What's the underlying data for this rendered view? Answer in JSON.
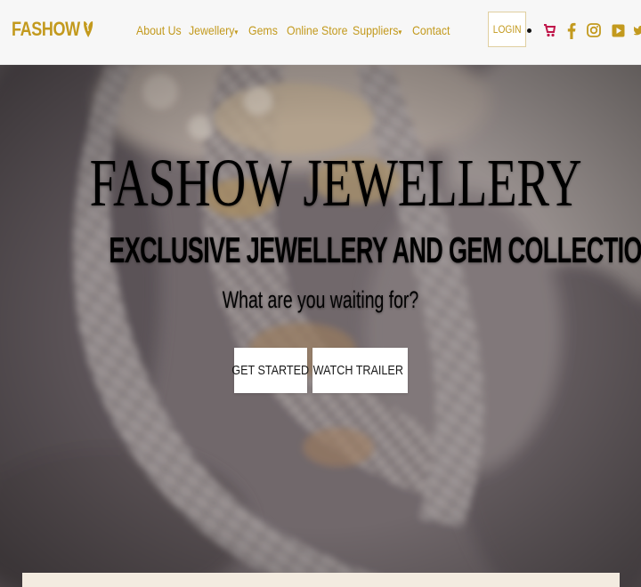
{
  "brand": {
    "name": "FASHOW",
    "color": "#c39a1e"
  },
  "nav": {
    "items": [
      {
        "label": "About Us",
        "caret": ""
      },
      {
        "label": "Jewellery",
        "caret": "▾"
      },
      {
        "label": "Gems",
        "caret": ""
      },
      {
        "label": "Online Store",
        "caret": ""
      },
      {
        "label": "Suppliers",
        "caret": "▾"
      },
      {
        "label": "Contact",
        "caret": ""
      }
    ],
    "login_label": "LOGIN"
  },
  "header_icons": [
    "cart-icon",
    "facebook-icon",
    "instagram-icon",
    "youtube-icon",
    "twitter-icon"
  ],
  "hero": {
    "title": "FASHOW JEWELLERY",
    "subtitle": "EXCLUSIVE JEWELLERY AND GEM COLLECTION",
    "tagline": "What are you waiting for?",
    "primary_button": "GET STARTED",
    "secondary_button": "WATCH TRAILER"
  },
  "colors": {
    "accent": "#c39a1e",
    "cart": "#c0164a",
    "panel": "#f3ebe0"
  }
}
